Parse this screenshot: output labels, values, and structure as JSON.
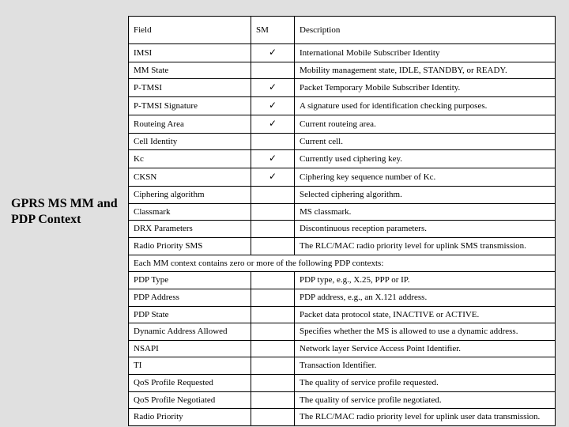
{
  "title": "GPRS MS MM and PDP Context",
  "header": {
    "field": "Field",
    "sm": "SM",
    "desc": "Description"
  },
  "check": "✓",
  "mm_rows": [
    {
      "field": "IMSI",
      "sm": true,
      "desc": "International Mobile Subscriber Identity"
    },
    {
      "field": "MM State",
      "sm": false,
      "desc": "Mobility management state, IDLE, STANDBY, or READY."
    },
    {
      "field": "P-TMSI",
      "sm": true,
      "desc": "Packet Temporary Mobile Subscriber Identity."
    },
    {
      "field": "P-TMSI Signature",
      "sm": true,
      "desc": "A signature used for identification checking purposes."
    },
    {
      "field": "Routeing Area",
      "sm": true,
      "desc": "Current routeing area."
    },
    {
      "field": "Cell Identity",
      "sm": false,
      "desc": "Current cell."
    },
    {
      "field": "Kc",
      "sm": true,
      "desc": "Currently used ciphering key."
    },
    {
      "field": "CKSN",
      "sm": true,
      "desc": "Ciphering key sequence number of Kc."
    },
    {
      "field": "Ciphering algorithm",
      "sm": false,
      "desc": "Selected ciphering algorithm."
    },
    {
      "field": "Classmark",
      "sm": false,
      "desc": "MS classmark."
    },
    {
      "field": "DRX Parameters",
      "sm": false,
      "desc": "Discontinuous reception parameters."
    },
    {
      "field": "Radio Priority SMS",
      "sm": false,
      "desc": "The RLC/MAC radio priority level for uplink SMS transmission."
    }
  ],
  "subsection_text": "Each MM context contains zero or more of the following PDP contexts:",
  "pdp_rows": [
    {
      "field": "PDP Type",
      "sm": false,
      "desc": "PDP type, e.g., X.25, PPP or IP."
    },
    {
      "field": "PDP Address",
      "sm": false,
      "desc": "PDP address, e.g., an X.121 address."
    },
    {
      "field": "PDP State",
      "sm": false,
      "desc": "Packet data protocol state, INACTIVE or ACTIVE."
    },
    {
      "field": "Dynamic Address Allowed",
      "sm": false,
      "desc": "Specifies whether the MS is allowed to use a dynamic address."
    },
    {
      "field": "NSAPI",
      "sm": false,
      "desc": "Network layer Service Access Point Identifier."
    },
    {
      "field": "TI",
      "sm": false,
      "desc": "Transaction Identifier."
    },
    {
      "field": "QoS Profile Requested",
      "sm": false,
      "desc": "The quality of service profile requested."
    },
    {
      "field": "QoS Profile Negotiated",
      "sm": false,
      "desc": "The quality of service profile negotiated."
    },
    {
      "field": "Radio Priority",
      "sm": false,
      "desc": "The RLC/MAC radio priority level for uplink user data transmission."
    }
  ]
}
